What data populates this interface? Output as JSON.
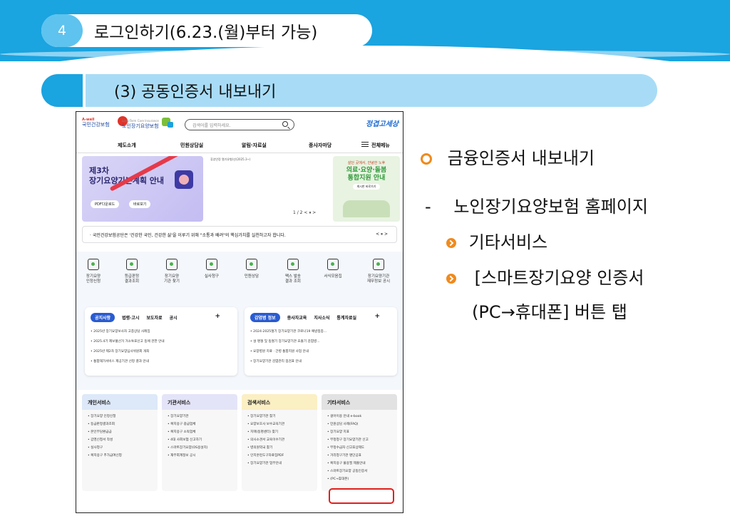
{
  "slide": {
    "section_number": "4",
    "section_title": "로그인하기(6.23.(월)부터 가능)",
    "subsection_title": "(3) 공동인증서 내보내기"
  },
  "bullets": {
    "main": "금융인증서 내보내기",
    "dash": "-",
    "step1": "노인장기요양보험 홈페이지",
    "step2": "기타서비스",
    "step3_line1": "[스마트장기요양 인증서",
    "step3_line2": "(PC→휴대폰] 버튼 탭",
    "accent_color": "#f08a1c"
  },
  "site": {
    "logo_main": "국민건강보험",
    "logo_main_small": "A-well",
    "logo_sub": "노인장기요양보험",
    "logo_sub_small": "Long-Term Care Insurance",
    "search_placeholder": "검색어를 입력하세요.",
    "slogan": "정겹고세상",
    "nav": [
      "제도소개",
      "민원상담실",
      "알림·자료실",
      "종사자마당",
      "전체메뉴"
    ],
    "banner_main": {
      "title_line1": "제3차",
      "title_line2": "장기요양기본계획 안내",
      "btn_pdf": "PDF다운로드",
      "btn_view": "바로보기"
    },
    "banner_notice": "휴양안정 열기유형(산(2025.3~)",
    "pager": "1 / 2  <  ⏸  >",
    "banner_side": {
      "small": "살던 곳에서, 안녕한 노후",
      "line1": "의료·요양·돌봄",
      "line2": "통합지원 안내",
      "btn": "게시판 바로가기"
    },
    "ticker": "· 국민건강보험공단은 '건강한 국민, 건강한 삶'을 이루기 위해 \"소통과 배려\"의 핵심가치를 실천하고자 합니다.",
    "ticker_controls": "<  ⏸  >",
    "quick_icons": [
      {
        "name": "ic-1",
        "l1": "장기요양",
        "l2": "인정신청"
      },
      {
        "name": "ic-2",
        "l1": "등급판정",
        "l2": "결과조회"
      },
      {
        "name": "ic-3",
        "l1": "장기요양",
        "l2": "기관 찾기"
      },
      {
        "name": "ic-4",
        "l1": "실사청구",
        "l2": ""
      },
      {
        "name": "ic-5",
        "l1": "민원상담",
        "l2": ""
      },
      {
        "name": "ic-6",
        "l1": "팩스 발송",
        "l2": "결과 조회"
      },
      {
        "name": "ic-7",
        "l1": "서식모음집",
        "l2": ""
      },
      {
        "name": "ic-8",
        "l1": "장기요양기관",
        "l2": "재무정보 공시"
      }
    ],
    "board_left": {
      "tabs": [
        "공지사항",
        "법령·고시",
        "보도자료",
        "공시"
      ],
      "items": [
        "2025년 장기요양보사자 고충상담 사례집",
        "2025.4기 제보혈선거 거소투표신고 등에 관한 안내",
        "2025년 제2차 장기요양심사위원회 개최",
        "통합재가서비스 제공기관 선정 결과 안내"
      ]
    },
    "board_right": {
      "tabs": [
        "감염병 정보",
        "종사자교육",
        "지사소식",
        "통계자료실"
      ],
      "items": [
        "2024-2025절기 장기요양기관 코로나19 예방접종...",
        "설 명절 및 동절기 장기요양기관 효출기 감염병...",
        "요양병원 치료 · 간병 통합지원 사업 안내",
        "장기요양기관 감염관리 점검표 안내"
      ]
    },
    "services": [
      {
        "title": "개인서비스",
        "header_color": "#dde8f8",
        "items": [
          "장기요양 인정신청",
          "등급판정결과조회",
          "본인부담환급금",
          "갑영신청서 작성",
          "실사청구",
          "복지용구 추가급여신청"
        ]
      },
      {
        "title": "기관서비스",
        "header_color": "#e4e4f8",
        "items": [
          "장기요양기관",
          "복지용구 광급업체",
          "복지용구 소독업체",
          "4대 사회보험 신고하기",
          "스마트장기요양(OS용설치)",
          "재무회계정보 공시"
        ]
      },
      {
        "title": "검색서비스",
        "header_color": "#fbefc4",
        "items": [
          "장기요양기관 찾기",
          "요양보호사 보수교육기관",
          "치매(동명센터) 찾기",
          "의사소견서 교육이수기관",
          "병의원약국 찾기",
          "인지훈련도구자료집PDF",
          "장기요양기관 업무안내"
        ]
      },
      {
        "title": "기타서비스",
        "header_color": "#e2e2e2",
        "items": [
          "걸어이용 안내 e-book",
          "민원상담 사례(FAQ)",
          "장기요양 지표",
          "부정청구 장기요양기관 신고",
          "부정수급자 신고포상제도",
          "거리청구기관 명단공표",
          "복지용구 불용필 제출안내",
          "스마트장기요양 공동인증서",
          "(PC→휴대폰)"
        ]
      }
    ]
  }
}
